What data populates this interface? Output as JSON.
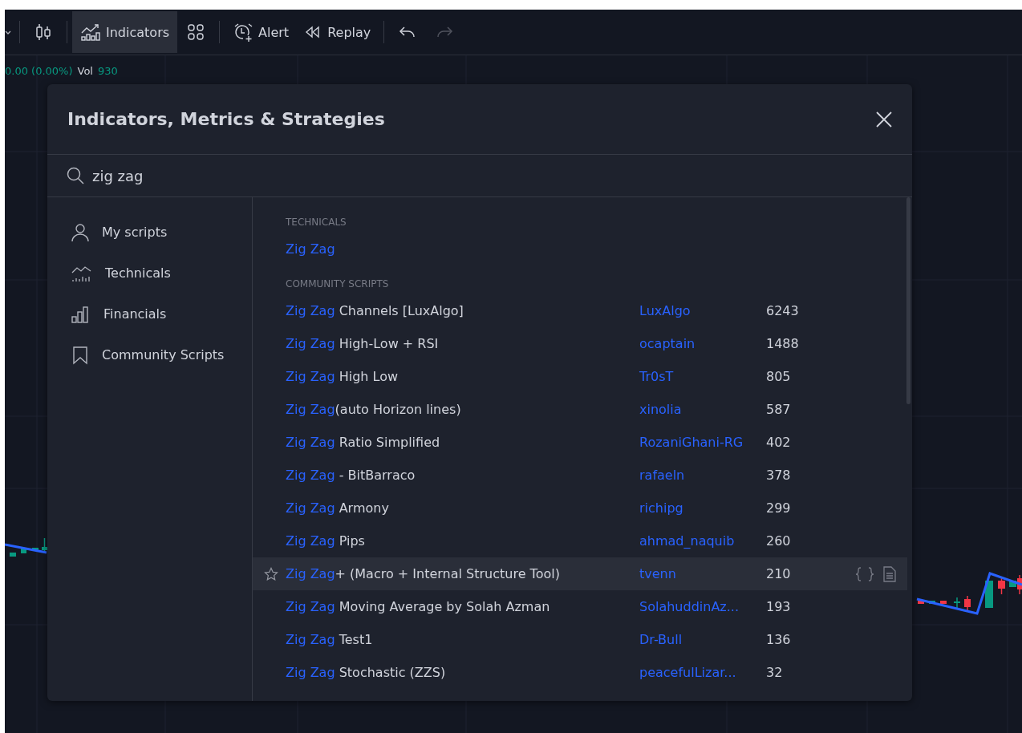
{
  "toolbar": [
    {
      "kind": "caret"
    },
    {
      "kind": "divider"
    },
    {
      "kind": "candles"
    },
    {
      "kind": "divider"
    },
    {
      "kind": "indicators",
      "label": "Indicators",
      "selected": true
    },
    {
      "kind": "grid"
    },
    {
      "kind": "divider"
    },
    {
      "kind": "alert",
      "label": "Alert"
    },
    {
      "kind": "replay",
      "label": "Replay"
    },
    {
      "kind": "divider"
    },
    {
      "kind": "undo",
      "disabled": false
    },
    {
      "kind": "redo",
      "disabled": true
    }
  ],
  "legend": {
    "change": "0.00 (0.00%)",
    "volume_label": "Vol",
    "volume": "930"
  },
  "dialog": {
    "title": "Indicators, Metrics & Strategies",
    "search": {
      "value": "zig zag"
    },
    "sidebar": [
      {
        "kind": "user",
        "label": "My scripts"
      },
      {
        "kind": "technicals",
        "label": "Technicals"
      },
      {
        "kind": "financials",
        "label": "Financials"
      },
      {
        "kind": "bookmark",
        "label": "Community Scripts"
      }
    ],
    "sections": [
      {
        "heading": "TECHNICALS",
        "rows": [
          {
            "match": "Zig Zag",
            "rest": "",
            "author": "",
            "count": "",
            "highlighted": false
          }
        ]
      },
      {
        "heading": "COMMUNITY SCRIPTS",
        "rows": [
          {
            "match": "Zig Zag",
            "rest": " Channels [LuxAlgo]",
            "author": "LuxAlgo",
            "count": "6243",
            "highlighted": false
          },
          {
            "match": "Zig Zag",
            "rest": " High-Low + RSI",
            "author": "ocaptain",
            "count": "1488",
            "highlighted": false
          },
          {
            "match": "Zig Zag",
            "rest": " High Low",
            "author": "Tr0sT",
            "count": "805",
            "highlighted": false
          },
          {
            "match": "Zig Zag",
            "rest": "(auto Horizon lines)",
            "author": "xinolia",
            "count": "587",
            "highlighted": false
          },
          {
            "match": "Zig Zag",
            "rest": " Ratio Simplified",
            "author": "RozaniGhani-RG",
            "count": "402",
            "highlighted": false
          },
          {
            "match": "Zig Zag",
            "rest": " - BitBarraco",
            "author": "rafaeln",
            "count": "378",
            "highlighted": false
          },
          {
            "match": "Zig Zag",
            "rest": " Armony",
            "author": "richipg",
            "count": "299",
            "highlighted": false
          },
          {
            "match": "Zig Zag",
            "rest": " Pips",
            "author": "ahmad_naquib",
            "count": "260",
            "highlighted": false
          },
          {
            "match": "Zig Zag",
            "rest": "+ (Macro + Internal Structure Tool)",
            "author": "tvenn",
            "count": "210",
            "highlighted": true
          },
          {
            "match": "Zig Zag",
            "rest": " Moving Average by Solah Azman",
            "author": "SolahuddinAz...",
            "count": "193",
            "highlighted": false
          },
          {
            "match": "Zig Zag",
            "rest": " Test1",
            "author": "Dr-Bull",
            "count": "136",
            "highlighted": false
          },
          {
            "match": "Zig Zag",
            "rest": " Stochastic (ZZS)",
            "author": "peacefulLizar...",
            "count": "32",
            "highlighted": false
          }
        ]
      }
    ]
  }
}
